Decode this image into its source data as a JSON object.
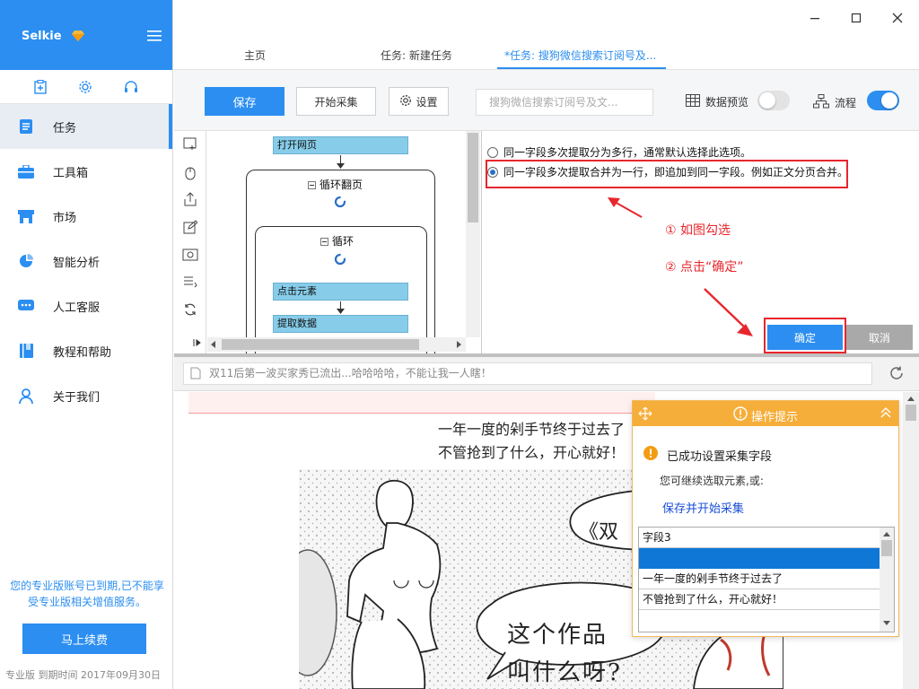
{
  "app": {
    "brand": "Selkie"
  },
  "sidebar": {
    "items": [
      {
        "label": "任务"
      },
      {
        "label": "工具箱"
      },
      {
        "label": "市场"
      },
      {
        "label": "智能分析"
      },
      {
        "label": "人工客服"
      },
      {
        "label": "教程和帮助"
      },
      {
        "label": "关于我们"
      }
    ],
    "expire_message": "您的专业版账号已到期,已不能享受专业版相关增值服务。",
    "renew_label": "马上续费",
    "footer": "专业版  到期时间 2017年09月30日"
  },
  "tabs": [
    {
      "label": "主页"
    },
    {
      "label": "任务: 新建任务"
    },
    {
      "label": "*任务: 搜狗微信搜索订阅号及..."
    }
  ],
  "toolbar": {
    "save_label": "保存",
    "start_label": "开始采集",
    "settings_label": "设置",
    "search_placeholder": "搜狗微信搜索订阅号及文...",
    "preview_label": "数据预览",
    "flow_label": "流程",
    "preview_on": false,
    "flow_on": true
  },
  "workflow": {
    "open_page": "打开网页",
    "loop_page": "循环翻页",
    "loop": "循环",
    "click_element": "点击元素",
    "extract_data": "提取数据"
  },
  "options": {
    "option1": "同一字段多次提取分为多行，通常默认选择此选项。",
    "option2": "同一字段多次提取合并为一行，即追加到同一字段。例如正文分页合并。",
    "selected": 2,
    "annotation1": "① 如图勾选",
    "annotation2": "② 点击“确定”",
    "ok_label": "确定",
    "cancel_label": "取消"
  },
  "browser": {
    "url_text": "双11后第一波买家秀已流出...哈哈哈哈，不能让我一人瞎！",
    "headline1": "一年一度的剁手节终于过去了",
    "headline2": "不管抢到了什么，开心就好！",
    "comic_text1": "《双",
    "comic_text2": "这个作品",
    "comic_text3": "叫什么呀?"
  },
  "tips": {
    "title": "操作提示",
    "success": "已成功设置采集字段",
    "sub": "您可继续选取元素,或:",
    "link": "保存并开始采集",
    "rows": [
      "字段3",
      "",
      "一年一度的剁手节终于过去了",
      "不管抢到了什么，开心就好！"
    ]
  },
  "colors": {
    "accent": "#2b8ef0",
    "annotation": "#e8262d",
    "tips_header": "#f6ae3a"
  }
}
